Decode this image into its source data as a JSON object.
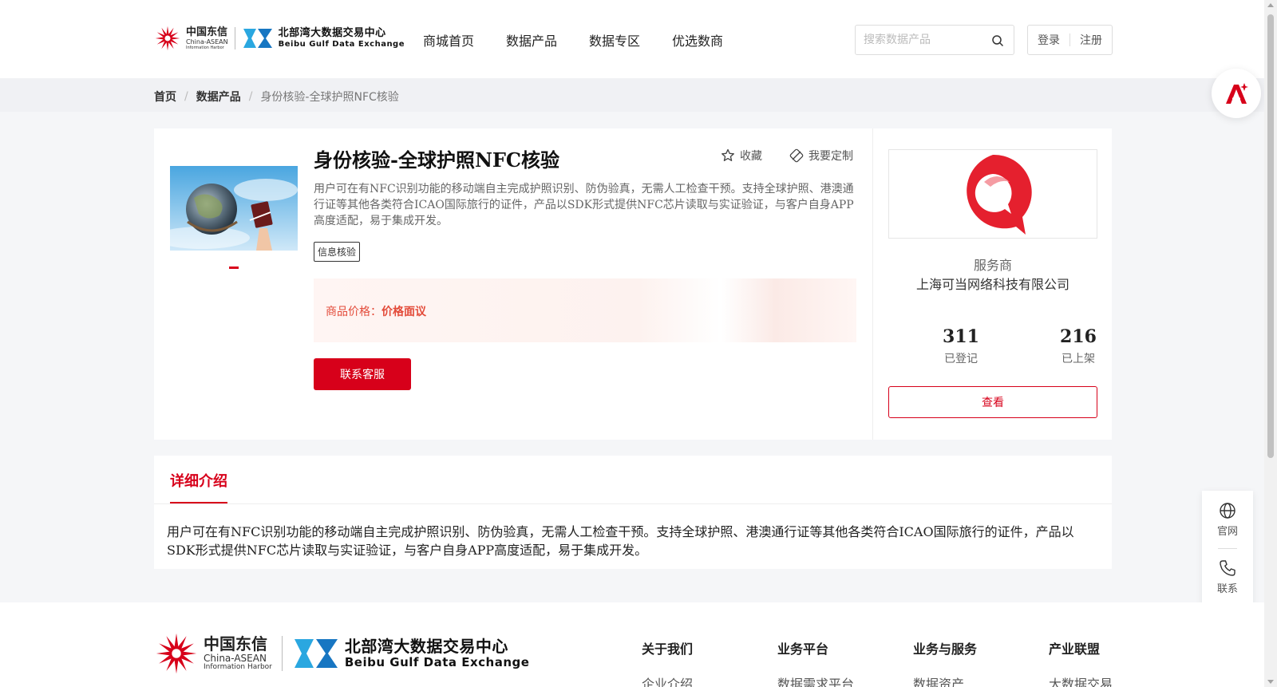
{
  "header": {
    "logo_ct_cn": "中国东信",
    "logo_ct_en1": "China-ASEAN",
    "logo_ct_en2": "Information Harbor",
    "logo_bd_cn": "北部湾大数据交易中心",
    "logo_bd_en": "Beibu Gulf Data Exchange",
    "nav": [
      "商城首页",
      "数据产品",
      "数据专区",
      "优选数商"
    ],
    "search_placeholder": "搜索数据产品",
    "login": "登录",
    "register": "注册"
  },
  "breadcrumb": {
    "home": "首页",
    "category": "数据产品",
    "current": "身份核验-全球护照NFC核验"
  },
  "product": {
    "title": "身份核验-全球护照NFC核验",
    "favorite": "收藏",
    "customize": "我要定制",
    "description": "用户可在有NFC识别功能的移动端自主完成护照识别、防伪验真，无需人工检查干预。支持全球护照、港澳通行证等其他各类符合ICAO国际旅行的证件，产品以SDK形式提供NFC芯片读取与实证验证，与客户自身APP高度适配，易于集成开发。",
    "tag": "信息核验",
    "price_label": "商品价格：",
    "price_value": "价格面议",
    "contact_button": "联系客服"
  },
  "provider": {
    "label": "服务商",
    "name": "上海可当网络科技有限公司",
    "registered_count": "311",
    "registered_label": "已登记",
    "listed_count": "216",
    "listed_label": "已上架",
    "view_button": "查看"
  },
  "detail": {
    "tab": "详细介绍",
    "text": "用户可在有NFC识别功能的移动端自主完成护照识别、防伪验真，无需人工检查干预。支持全球护照、港澳通行证等其他各类符合ICAO国际旅行的证件，产品以SDK形式提供NFC芯片读取与实证验证，与客户自身APP高度适配，易于集成开发。"
  },
  "side_float": {
    "website": "官网",
    "contact": "联系"
  },
  "footer": {
    "columns": [
      {
        "heading": "关于我们",
        "link": "企业介绍"
      },
      {
        "heading": "业务平台",
        "link": "数据需求平台"
      },
      {
        "heading": "业务与服务",
        "link": "数据资产"
      },
      {
        "heading": "产业联盟",
        "link": "大数据交易"
      }
    ]
  },
  "colors": {
    "brand_red": "#d7001a",
    "price_red": "#e34b3a",
    "page_bg": "#f5f6f8"
  }
}
